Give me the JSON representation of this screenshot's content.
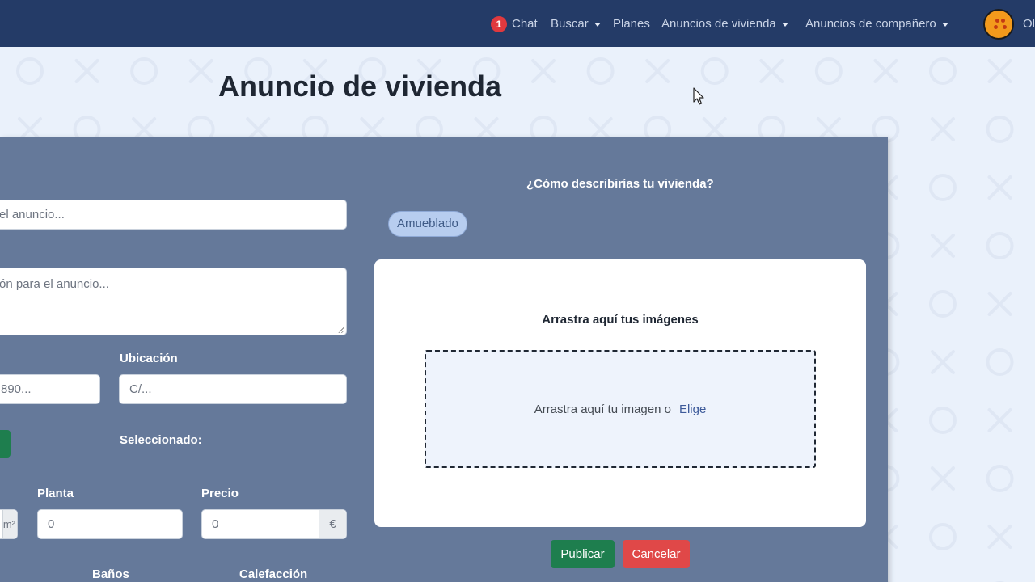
{
  "navbar": {
    "chat_badge": "1",
    "chat_label": "Chat",
    "search_label": "Buscar",
    "plans_label": "Planes",
    "housing_ads_label": "Anuncios de vivienda",
    "roommate_ads_label": "Anuncios de compañero",
    "user_name": "Ol"
  },
  "page": {
    "title": "Anuncio de vivienda"
  },
  "form": {
    "title_placeholder": "el anuncio...",
    "description_placeholder": "ón para el anuncio...",
    "location_label": "Ubicación",
    "phone_placeholder": "890...",
    "location_placeholder": "C/...",
    "selected_label": "Seleccionado:",
    "area_suffix": "m²",
    "floor_label": "Planta",
    "floor_value": "0",
    "price_label": "Precio",
    "price_value": "0",
    "price_suffix": "€",
    "bathrooms_label": "Baños",
    "heating_label": "Calefacción"
  },
  "describe": {
    "question": "¿Cómo describirías tu vivienda?",
    "tags": [
      "Amueblado"
    ]
  },
  "upload": {
    "title": "Arrastra aquí tus imágenes",
    "drop_text": "Arrastra aquí tu imagen o",
    "choose_link": "Elige"
  },
  "actions": {
    "publish_label": "Publicar",
    "cancel_label": "Cancelar"
  },
  "colors": {
    "navbar": "#243b67",
    "panel": "#65799a",
    "publish": "#1e7e4e",
    "cancel": "#e04848",
    "badge": "#e0393e"
  }
}
